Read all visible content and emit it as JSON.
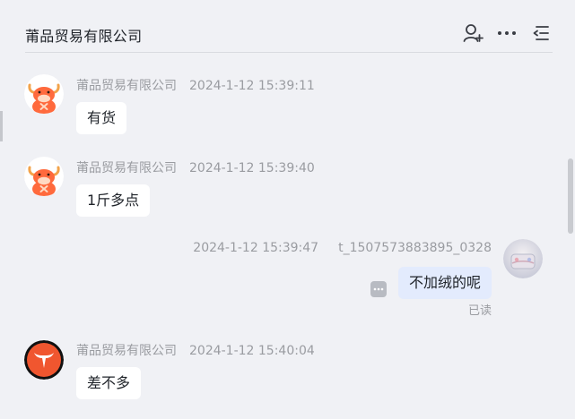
{
  "header": {
    "title": "莆品贸易有限公司",
    "icons": [
      "add-user-icon",
      "more-icon",
      "menu-collapse-icon"
    ]
  },
  "messages": [
    {
      "sender": "莆品贸易有限公司",
      "time": "2024-1-12 15:39:11",
      "text": "有货",
      "avatar": "ox-cartoon-avatar"
    },
    {
      "sender": "莆品贸易有限公司",
      "time": "2024-1-12 15:39:40",
      "text": "1斤多点",
      "avatar": "ox-cartoon-avatar"
    },
    {
      "sender": "t_1507573883895_0328",
      "time": "2024-1-12 15:39:47",
      "text": "不加绒的呢",
      "status": "已读",
      "avatar": "user-photo-avatar"
    },
    {
      "sender": "莆品贸易有限公司",
      "time": "2024-1-12 15:40:04",
      "text": "差不多",
      "avatar": "ox-logo-avatar"
    }
  ],
  "colors": {
    "background": "#f0f1f5",
    "bubble_other": "#ffffff",
    "bubble_mine": "#e3ebfd",
    "meta_text": "#9a9ca1",
    "ox_orange": "#ff6a3d",
    "logo_red": "#f0562f"
  }
}
